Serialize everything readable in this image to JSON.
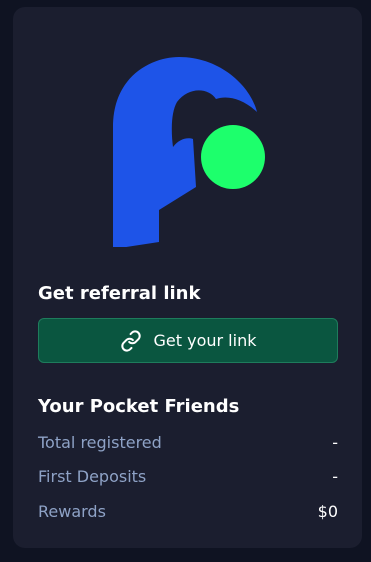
{
  "colors": {
    "background": "#0f1322",
    "card": "#1b1e2f",
    "logo_blue": "#1e54e8",
    "logo_green": "#1dff6c",
    "button_bg": "#0a5640",
    "label_color": "#8ea2c6"
  },
  "referral": {
    "title": "Get referral link",
    "button_label": "Get your link",
    "button_icon": "link-icon"
  },
  "friends": {
    "title": "Your Pocket Friends",
    "stats": [
      {
        "label": "Total registered",
        "value": "-"
      },
      {
        "label": "First Deposits",
        "value": "-"
      },
      {
        "label": "Rewards",
        "value": "$0"
      }
    ]
  }
}
